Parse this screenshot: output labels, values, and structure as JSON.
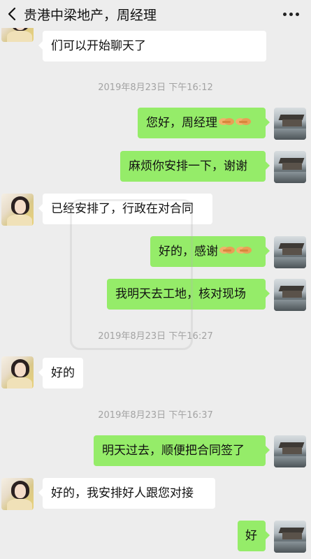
{
  "header": {
    "back_icon": "chevron-left-icon",
    "title": "贵港中梁地产，周经理",
    "more_icon": "more-dots-icon"
  },
  "messages": [
    {
      "type": "in",
      "text": "们可以开始聊天了"
    },
    {
      "type": "time",
      "text": "2019年8月23日 下午16:12"
    },
    {
      "type": "out",
      "text": "您好，周经理",
      "emoji": "handshake-emoji"
    },
    {
      "type": "out",
      "text": "麻烦你安排一下，谢谢"
    },
    {
      "type": "in",
      "text": "已经安排了，行政在对合同"
    },
    {
      "type": "out",
      "text": "好的，感谢",
      "emoji": "handshake-emoji"
    },
    {
      "type": "out",
      "text": "我明天去工地，核对现场"
    },
    {
      "type": "time",
      "text": "2019年8月23日 下午16:27"
    },
    {
      "type": "in",
      "text": "好的"
    },
    {
      "type": "time",
      "text": "2019年8月23日 下午16:37"
    },
    {
      "type": "out",
      "text": "明天过去，顺便把合同签了"
    },
    {
      "type": "in",
      "text": "好的，我安排好人跟您对接"
    },
    {
      "type": "out",
      "text": "好"
    }
  ],
  "colors": {
    "background": "#ededed",
    "incoming_bubble": "#ffffff",
    "outgoing_bubble": "#95ec69",
    "timestamp_text": "#a3a3a3"
  }
}
